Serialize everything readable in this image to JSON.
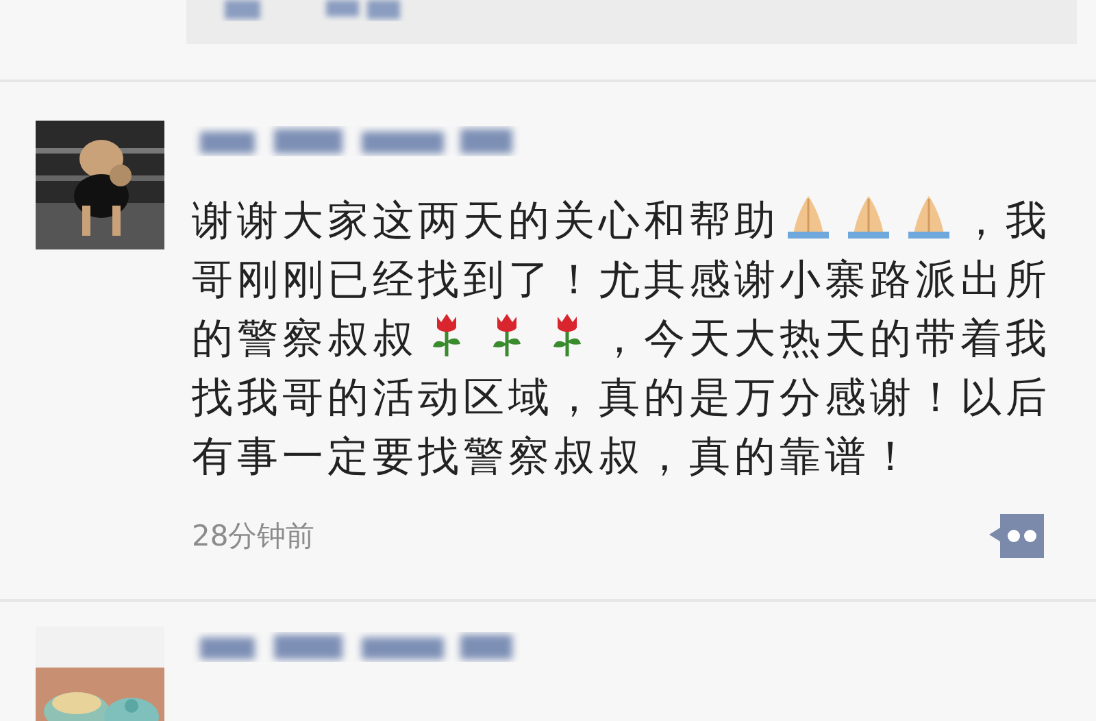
{
  "posts": [
    {
      "kind": "partial"
    },
    {
      "kind": "full",
      "content": [
        {
          "kind": "text",
          "text": "谢谢大家这两天的关心和帮助"
        },
        {
          "kind": "palms"
        },
        {
          "kind": "palms"
        },
        {
          "kind": "palms"
        },
        {
          "kind": "text",
          "text": "，我哥刚刚已经找到了！尤其感谢小寨路派出所的警察叔叔"
        },
        {
          "kind": "rose"
        },
        {
          "kind": "rose"
        },
        {
          "kind": "rose"
        },
        {
          "kind": "text",
          "text": "，今天大热天的带着我找我哥的活动区域，真的是万分感谢！以后有事一定要找警察叔叔，真的靠谱！"
        }
      ],
      "time": "28分钟前"
    },
    {
      "kind": "cut"
    }
  ]
}
